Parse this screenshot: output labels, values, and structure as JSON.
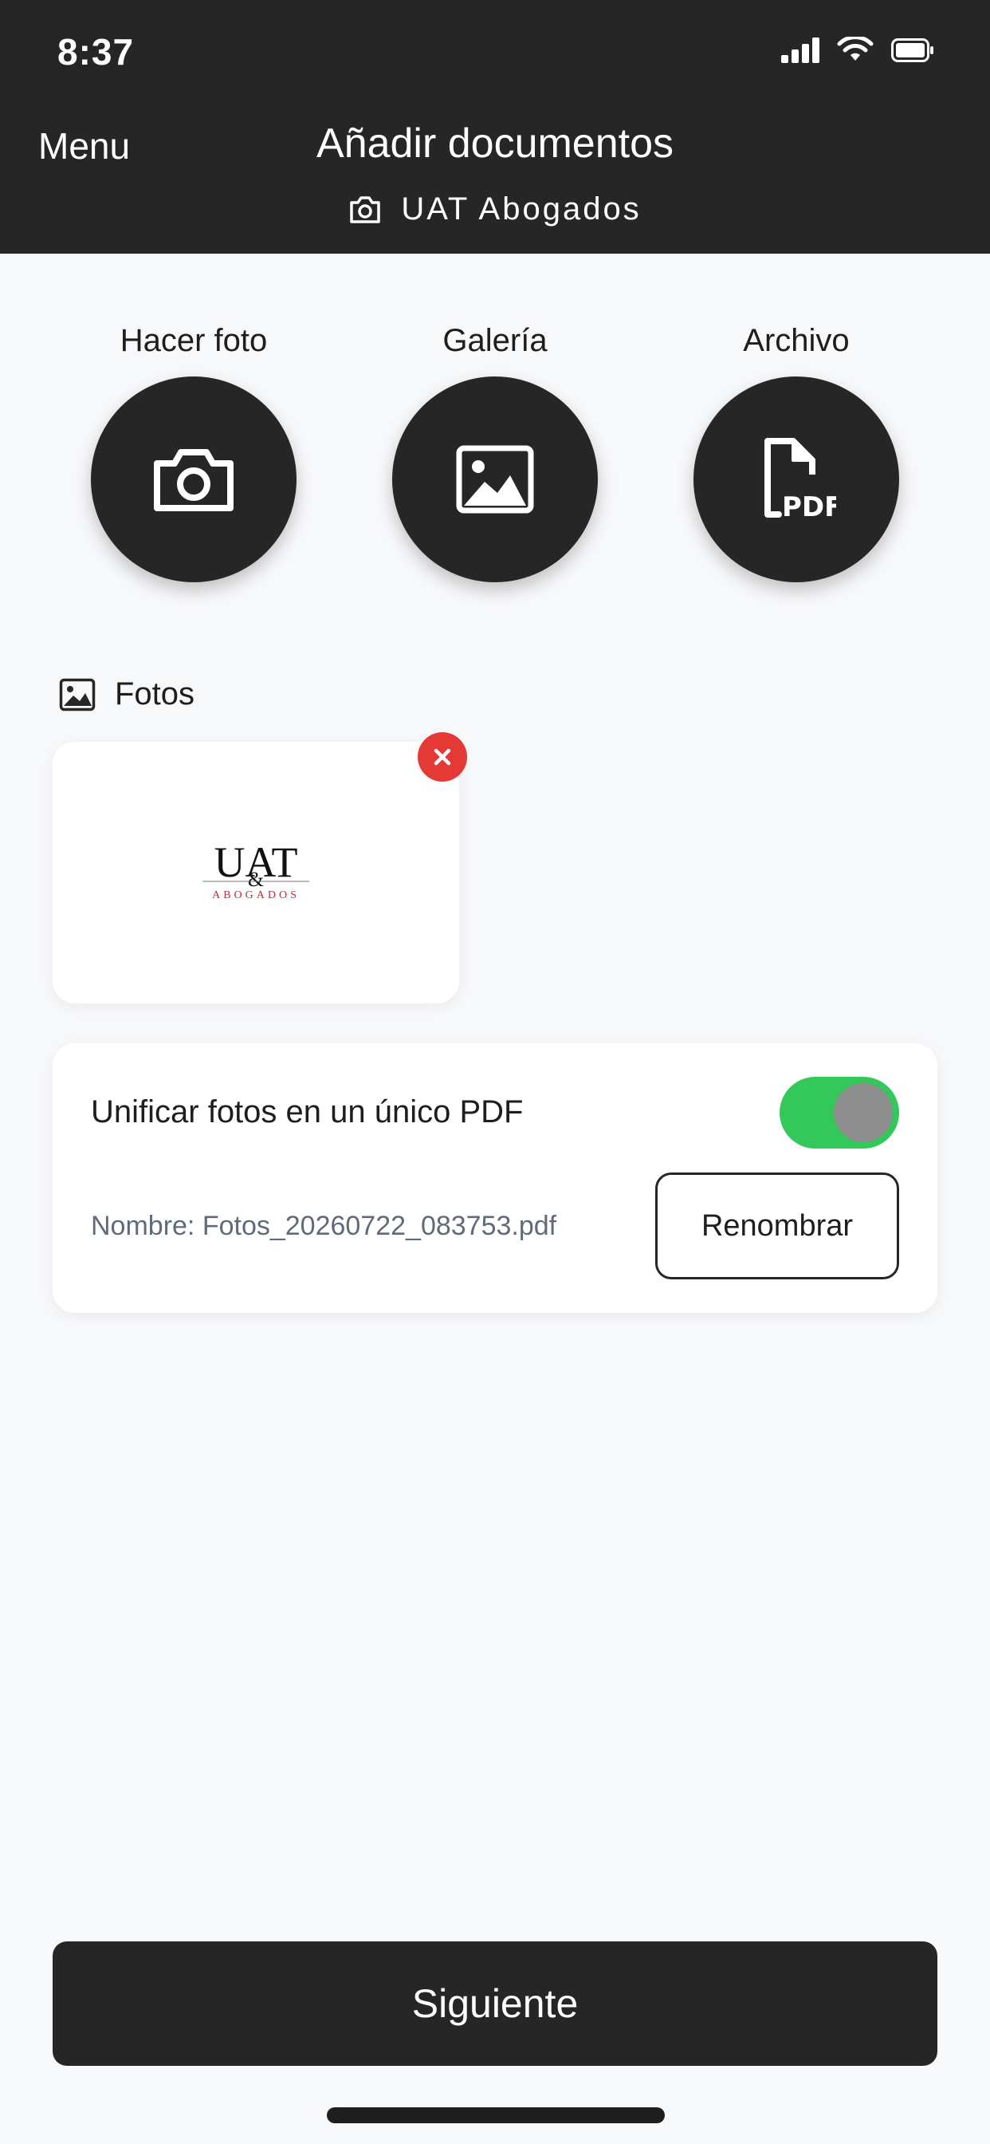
{
  "status_bar": {
    "time": "8:37"
  },
  "header": {
    "menu_label": "Menu",
    "title": "Añadir documentos",
    "subtitle": "UAT Abogados"
  },
  "actions": [
    {
      "label": "Hacer foto",
      "icon": "camera-icon"
    },
    {
      "label": "Galería",
      "icon": "image-icon"
    },
    {
      "label": "Archivo",
      "icon": "pdf-file-icon"
    }
  ],
  "photos_section": {
    "label": "Fotos",
    "thumbnail": {
      "logo_main": "UAT",
      "logo_sub": "ABOGADOS"
    }
  },
  "unify": {
    "label": "Unificar fotos en un único PDF",
    "enabled": true,
    "file_name": "Nombre: Fotos_20260722_083753.pdf",
    "rename_label": "Renombrar"
  },
  "footer": {
    "next_label": "Siguiente"
  },
  "colors": {
    "header_bg": "#262626",
    "toggle_on": "#34c759",
    "remove_badge": "#e53935",
    "logo_red": "#c62839"
  }
}
